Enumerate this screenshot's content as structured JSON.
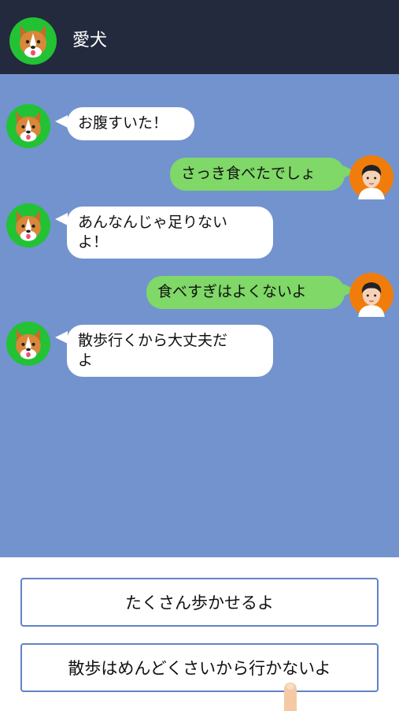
{
  "header": {
    "title": "愛犬",
    "avatar_icon": "corgi-dog-avatar-icon"
  },
  "colors": {
    "header_bg": "#232a3d",
    "chat_bg": "#7293ce",
    "bubble_incoming": "#ffffff",
    "bubble_outgoing": "#7fd867",
    "avatar_bg": "#22c234",
    "user_avatar_bg": "#f07d0b",
    "choice_border": "#5f83c8"
  },
  "messages": [
    {
      "sender": "dog",
      "text": "お腹すいた！"
    },
    {
      "sender": "user",
      "text": "さっき食べたでしょ"
    },
    {
      "sender": "dog",
      "text": "あんなんじゃ足りない\nよ！"
    },
    {
      "sender": "user",
      "text": "食べすぎはよくないよ"
    },
    {
      "sender": "dog",
      "text": "散歩行くから大丈夫だ\nよ"
    }
  ],
  "choices": [
    {
      "label": "たくさん歩かせるよ"
    },
    {
      "label": "散歩はめんどくさいから行かないよ"
    }
  ],
  "pointer_icon": "tap-finger-icon"
}
